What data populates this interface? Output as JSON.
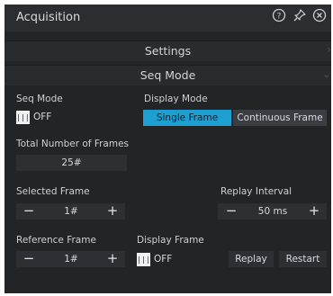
{
  "panel": {
    "title": "Acquisition"
  },
  "icons": {
    "help": "help-circle-icon",
    "pin": "pin-icon",
    "close": "close-circle-icon"
  },
  "sections": {
    "settings": "Settings",
    "seq_mode": "Seq Mode"
  },
  "seq_mode": {
    "label": "Seq Mode",
    "toggle_text": "OFF"
  },
  "display_mode": {
    "label": "Display Mode",
    "options": [
      "Single Frame",
      "Continuous Frame"
    ],
    "selected": "Single Frame"
  },
  "total_frames": {
    "label": "Total Number of Frames",
    "value": "25#"
  },
  "selected_frame": {
    "label": "Selected Frame",
    "minus": "−",
    "value": "1#",
    "plus": "+"
  },
  "replay_interval": {
    "label": "Replay Interval",
    "minus": "−",
    "value": "50 ms",
    "plus": "+"
  },
  "reference_frame": {
    "label": "Reference Frame",
    "minus": "−",
    "value": "1#",
    "plus": "+"
  },
  "display_frame": {
    "label": "Display Frame",
    "toggle_text": "OFF"
  },
  "buttons": {
    "replay": "Replay",
    "restart": "Restart"
  },
  "colors": {
    "accent": "#1e9fd2",
    "panel_bg": "#232426"
  }
}
